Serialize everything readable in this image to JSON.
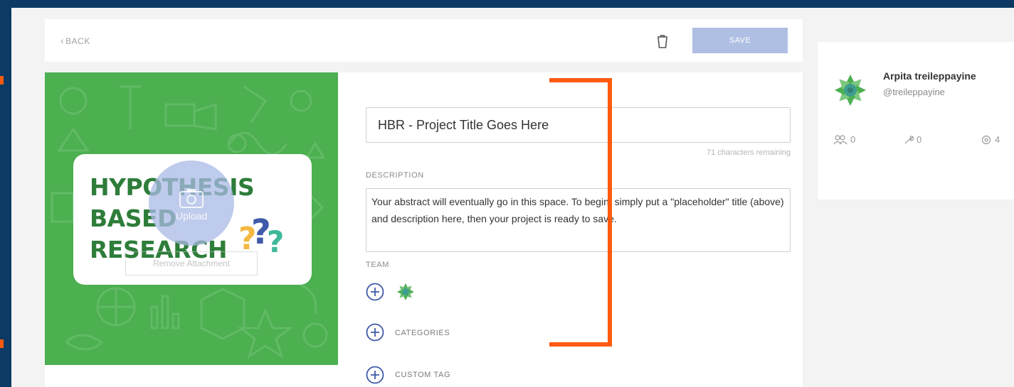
{
  "toolbar": {
    "back_label": "BACK",
    "save_label": "SAVE"
  },
  "cover": {
    "logo_lines": [
      "HYPOTHESIS",
      "BASED",
      "RESEARCH"
    ],
    "upload_label": "Upload",
    "remove_label": "Remove Attachment"
  },
  "form": {
    "title_value": "HBR - Project Title Goes Here",
    "remaining_text": "71 characters remaining",
    "description_label": "DESCRIPTION",
    "description_value": "Your abstract will eventually go in this space. To begin, simply put a \"placeholder\" title (above) and description here, then your project is ready to save.",
    "team_label": "TEAM",
    "categories_label": "CATEGORIES",
    "custom_tag_label": "CUSTOM TAG"
  },
  "profile": {
    "name": "Arpita treileppayine",
    "handle": "@treileppayine",
    "stats": {
      "followers": "0",
      "tools": "0",
      "projects": "4"
    }
  },
  "icons": {
    "back": "chevron-left-icon",
    "trash": "trash-icon",
    "upload": "camera-icon",
    "add": "plus-circle-icon",
    "followers": "people-icon",
    "tools": "wrench-icon",
    "projects": "badge-icon"
  },
  "colors": {
    "background": "#0c3a64",
    "save_button": "#aebfe3",
    "cover_green": "#4caf50",
    "logo_green": "#2e7d3a",
    "accent_blue": "#3f5aa8",
    "annotation_orange": "#ff5a0f"
  }
}
